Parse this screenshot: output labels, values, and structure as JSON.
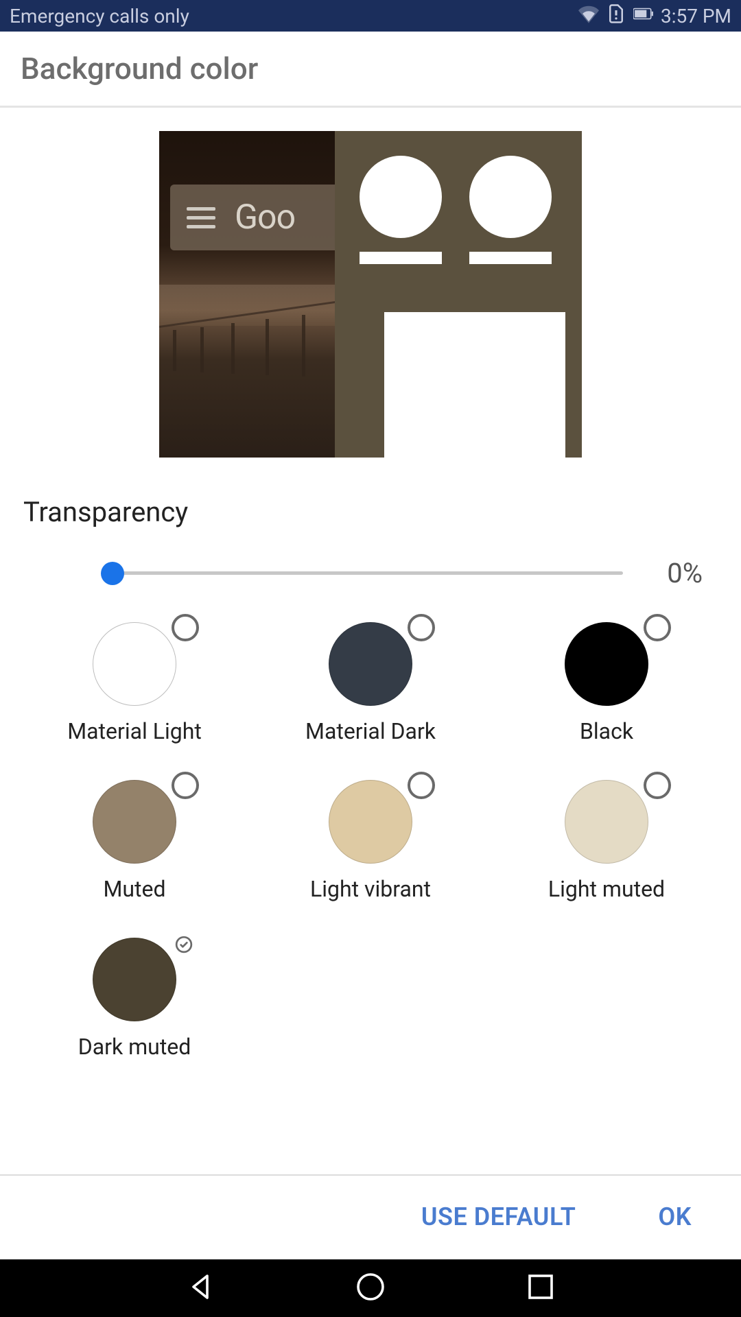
{
  "status": {
    "left_text": "Emergency calls only",
    "time": "3:57 PM"
  },
  "header": {
    "title": "Background color"
  },
  "preview": {
    "search_text": "Goo"
  },
  "transparency": {
    "label": "Transparency",
    "value_label": "0%",
    "value": 0
  },
  "colors": [
    {
      "label": "Material Light",
      "hex": "#ffffff",
      "selected": false
    },
    {
      "label": "Material Dark",
      "hex": "#343c47",
      "selected": false
    },
    {
      "label": "Black",
      "hex": "#000000",
      "selected": false
    },
    {
      "label": "Muted",
      "hex": "#94826a",
      "selected": false
    },
    {
      "label": "Light vibrant",
      "hex": "#decaa3",
      "selected": false
    },
    {
      "label": "Light muted",
      "hex": "#e4dbc5",
      "selected": false
    },
    {
      "label": "Dark muted",
      "hex": "#4b4231",
      "selected": true
    }
  ],
  "footer": {
    "default": "USE DEFAULT",
    "ok": "OK"
  }
}
